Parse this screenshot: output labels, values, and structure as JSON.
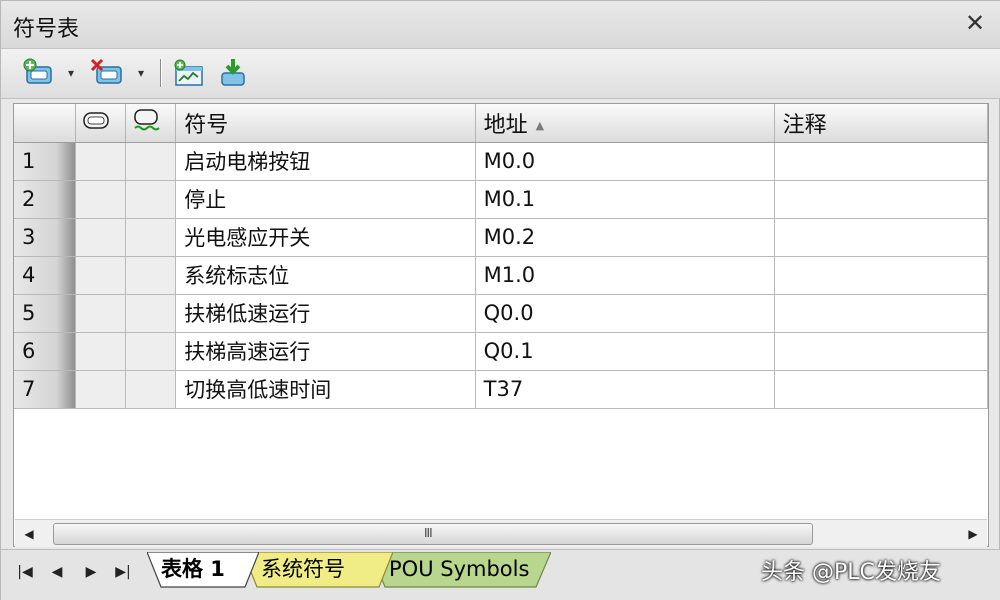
{
  "window": {
    "title": "符号表",
    "close_label": "✕"
  },
  "toolbar": {
    "buttons": [
      {
        "name": "insert-row",
        "icon": "insert-row-icon"
      },
      {
        "name": "delete-row",
        "icon": "delete-row-icon"
      },
      {
        "name": "create-unused",
        "icon": "table-chart-icon"
      },
      {
        "name": "apply-to-program",
        "icon": "apply-download-icon"
      }
    ]
  },
  "grid": {
    "headers": {
      "rownum": "",
      "overlap_icon": "overlap-indicator-icon",
      "unused_icon": "unused-indicator-icon",
      "symbol": "符号",
      "address": "地址",
      "comment": "注释"
    },
    "sort_indicator": "▲",
    "rows": [
      {
        "num": "1",
        "symbol": "启动电梯按钮",
        "address": "M0.0",
        "comment": ""
      },
      {
        "num": "2",
        "symbol": "停止",
        "address": "M0.1",
        "comment": ""
      },
      {
        "num": "3",
        "symbol": "光电感应开关",
        "address": "M0.2",
        "comment": ""
      },
      {
        "num": "4",
        "symbol": "系统标志位",
        "address": "M1.0",
        "comment": ""
      },
      {
        "num": "5",
        "symbol": "扶梯低速运行",
        "address": "Q0.0",
        "comment": ""
      },
      {
        "num": "6",
        "symbol": "扶梯高速运行",
        "address": "Q0.1",
        "comment": ""
      },
      {
        "num": "7",
        "symbol": "切换高低速时间",
        "address": "T37",
        "comment": ""
      }
    ]
  },
  "scrollbar": {
    "left_arrow": "◀",
    "right_arrow": "▶",
    "grip": "III"
  },
  "tabs": {
    "nav": {
      "first": "|◀",
      "prev": "◀",
      "next": "▶",
      "last": "▶|"
    },
    "items": [
      {
        "label": "表格 1",
        "active": true,
        "color": "#ffffff"
      },
      {
        "label": "系统符号",
        "active": false,
        "color": "#f0ec86"
      },
      {
        "label": "POU Symbols",
        "active": false,
        "color": "#b9d68f"
      }
    ]
  },
  "watermark": {
    "text": "头条 @PLC发烧友",
    "logo_text": "PLC发烧友"
  }
}
